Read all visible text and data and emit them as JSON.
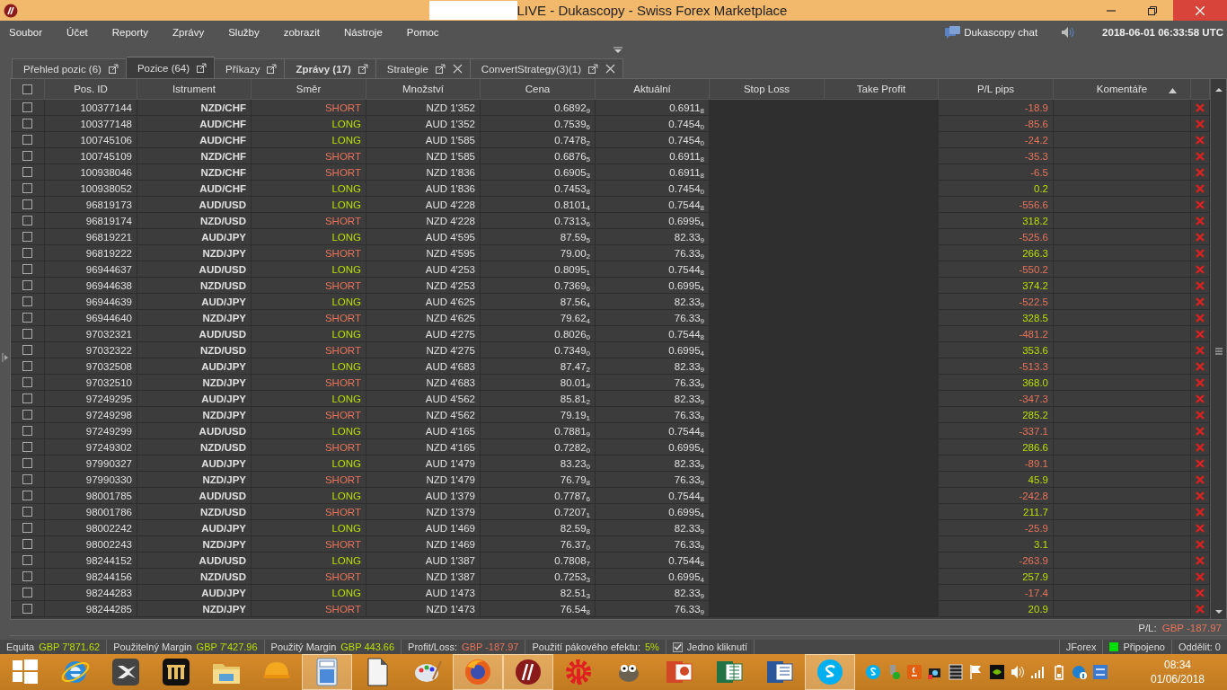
{
  "window": {
    "title": "LIVE - Dukascopy - Swiss Forex Marketplace"
  },
  "menu": [
    "Soubor",
    "Účet",
    "Reporty",
    "Zprávy",
    "Služby",
    "zobrazit",
    "Nástroje",
    "Pomoc"
  ],
  "chat_label": "Dukascopy chat",
  "server_time": "2018-06-01 06:33:58 UTC",
  "tabs": [
    {
      "label": "Přehled pozic (6)",
      "selected": false,
      "closable": false,
      "unread": false
    },
    {
      "label": "Pozice (64)",
      "selected": true,
      "closable": false,
      "unread": false
    },
    {
      "label": "Příkazy",
      "selected": false,
      "closable": false,
      "unread": false
    },
    {
      "label": "Zprávy (17)",
      "selected": false,
      "closable": false,
      "unread": true
    },
    {
      "label": "Strategie",
      "selected": false,
      "closable": true,
      "unread": false
    },
    {
      "label": "ConvertStrategy(3)(1)",
      "selected": false,
      "closable": true,
      "unread": false
    }
  ],
  "table": {
    "select_all_checked": false,
    "columns": [
      {
        "label": "Pos. ID",
        "sorted": false
      },
      {
        "label": "Istrument",
        "sorted": false
      },
      {
        "label": "Směr",
        "sorted": false
      },
      {
        "label": "Množství",
        "sorted": false
      },
      {
        "label": "Cena",
        "sorted": false
      },
      {
        "label": "Aktuální",
        "sorted": false
      },
      {
        "label": "Stop Loss",
        "sorted": false
      },
      {
        "label": "Take Profit",
        "sorted": false
      },
      {
        "label": "P/L pips",
        "sorted": false
      },
      {
        "label": "Komentáře",
        "sorted": true
      }
    ],
    "rows": [
      {
        "checked": false,
        "id": "100377144",
        "instrument": "NZD/CHF",
        "side": "SHORT",
        "long": false,
        "amount": "NZD 1'352",
        "price": "0.6892$_{9}$",
        "current": "0.6911$_{8}$",
        "pl": "-18.9",
        "gain": false
      },
      {
        "checked": false,
        "id": "100377148",
        "instrument": "AUD/CHF",
        "side": "LONG",
        "long": true,
        "amount": "AUD 1'352",
        "price": "0.7539$_{6}$",
        "current": "0.7454$_{0}$",
        "pl": "-85.6",
        "gain": false
      },
      {
        "checked": false,
        "id": "100745106",
        "instrument": "AUD/CHF",
        "side": "LONG",
        "long": true,
        "amount": "AUD 1'585",
        "price": "0.7478$_{2}$",
        "current": "0.7454$_{0}$",
        "pl": "-24.2",
        "gain": false
      },
      {
        "checked": false,
        "id": "100745109",
        "instrument": "NZD/CHF",
        "side": "SHORT",
        "long": false,
        "amount": "NZD 1'585",
        "price": "0.6876$_{5}$",
        "current": "0.6911$_{8}$",
        "pl": "-35.3",
        "gain": false
      },
      {
        "checked": false,
        "id": "100938046",
        "instrument": "NZD/CHF",
        "side": "SHORT",
        "long": false,
        "amount": "NZD 1'836",
        "price": "0.6905$_{3}$",
        "current": "0.6911$_{8}$",
        "pl": "-6.5",
        "gain": false
      },
      {
        "checked": false,
        "id": "100938052",
        "instrument": "AUD/CHF",
        "side": "LONG",
        "long": true,
        "amount": "AUD 1'836",
        "price": "0.7453$_{8}$",
        "current": "0.7454$_{0}$",
        "pl": "0.2",
        "gain": true
      },
      {
        "checked": false,
        "id": "96819173",
        "instrument": "AUD/USD",
        "side": "LONG",
        "long": true,
        "amount": "AUD 4'228",
        "price": "0.8101$_{4}$",
        "current": "0.7544$_{8}$",
        "pl": "-556.6",
        "gain": false
      },
      {
        "checked": false,
        "id": "96819174",
        "instrument": "NZD/USD",
        "side": "SHORT",
        "long": false,
        "amount": "NZD 4'228",
        "price": "0.7313$_{6}$",
        "current": "0.6995$_{4}$",
        "pl": "318.2",
        "gain": true
      },
      {
        "checked": false,
        "id": "96819221",
        "instrument": "AUD/JPY",
        "side": "LONG",
        "long": true,
        "amount": "AUD 4'595",
        "price": "87.59$_{5}$",
        "current": "82.33$_{9}$",
        "pl": "-525.6",
        "gain": false
      },
      {
        "checked": false,
        "id": "96819222",
        "instrument": "NZD/JPY",
        "side": "SHORT",
        "long": false,
        "amount": "NZD 4'595",
        "price": "79.00$_{2}$",
        "current": "76.33$_{9}$",
        "pl": "266.3",
        "gain": true
      },
      {
        "checked": false,
        "id": "96944637",
        "instrument": "AUD/USD",
        "side": "LONG",
        "long": true,
        "amount": "AUD 4'253",
        "price": "0.8095$_{1}$",
        "current": "0.7544$_{8}$",
        "pl": "-550.2",
        "gain": false
      },
      {
        "checked": false,
        "id": "96944638",
        "instrument": "NZD/USD",
        "side": "SHORT",
        "long": false,
        "amount": "NZD 4'253",
        "price": "0.7369$_{6}$",
        "current": "0.6995$_{4}$",
        "pl": "374.2",
        "gain": true
      },
      {
        "checked": false,
        "id": "96944639",
        "instrument": "AUD/JPY",
        "side": "LONG",
        "long": true,
        "amount": "AUD 4'625",
        "price": "87.56$_{4}$",
        "current": "82.33$_{9}$",
        "pl": "-522.5",
        "gain": false
      },
      {
        "checked": false,
        "id": "96944640",
        "instrument": "NZD/JPY",
        "side": "SHORT",
        "long": false,
        "amount": "NZD 4'625",
        "price": "79.62$_{4}$",
        "current": "76.33$_{9}$",
        "pl": "328.5",
        "gain": true
      },
      {
        "checked": false,
        "id": "97032321",
        "instrument": "AUD/USD",
        "side": "LONG",
        "long": true,
        "amount": "AUD 4'275",
        "price": "0.8026$_{0}$",
        "current": "0.7544$_{8}$",
        "pl": "-481.2",
        "gain": false
      },
      {
        "checked": false,
        "id": "97032322",
        "instrument": "NZD/USD",
        "side": "SHORT",
        "long": false,
        "amount": "NZD 4'275",
        "price": "0.7349$_{0}$",
        "current": "0.6995$_{4}$",
        "pl": "353.6",
        "gain": true
      },
      {
        "checked": false,
        "id": "97032508",
        "instrument": "AUD/JPY",
        "side": "LONG",
        "long": true,
        "amount": "AUD 4'683",
        "price": "87.47$_{2}$",
        "current": "82.33$_{9}$",
        "pl": "-513.3",
        "gain": false
      },
      {
        "checked": false,
        "id": "97032510",
        "instrument": "NZD/JPY",
        "side": "SHORT",
        "long": false,
        "amount": "NZD 4'683",
        "price": "80.01$_{9}$",
        "current": "76.33$_{9}$",
        "pl": "368.0",
        "gain": true
      },
      {
        "checked": false,
        "id": "97249295",
        "instrument": "AUD/JPY",
        "side": "LONG",
        "long": true,
        "amount": "AUD 4'562",
        "price": "85.81$_{2}$",
        "current": "82.33$_{9}$",
        "pl": "-347.3",
        "gain": false
      },
      {
        "checked": false,
        "id": "97249298",
        "instrument": "NZD/JPY",
        "side": "SHORT",
        "long": false,
        "amount": "NZD 4'562",
        "price": "79.19$_{1}$",
        "current": "76.33$_{9}$",
        "pl": "285.2",
        "gain": true
      },
      {
        "checked": false,
        "id": "97249299",
        "instrument": "AUD/USD",
        "side": "LONG",
        "long": true,
        "amount": "AUD 4'165",
        "price": "0.7881$_{9}$",
        "current": "0.7544$_{8}$",
        "pl": "-337.1",
        "gain": false
      },
      {
        "checked": false,
        "id": "97249302",
        "instrument": "NZD/USD",
        "side": "SHORT",
        "long": false,
        "amount": "NZD 4'165",
        "price": "0.7282$_{0}$",
        "current": "0.6995$_{4}$",
        "pl": "286.6",
        "gain": true
      },
      {
        "checked": false,
        "id": "97990327",
        "instrument": "AUD/JPY",
        "side": "LONG",
        "long": true,
        "amount": "AUD 1'479",
        "price": "83.23$_{0}$",
        "current": "82.33$_{9}$",
        "pl": "-89.1",
        "gain": false
      },
      {
        "checked": false,
        "id": "97990330",
        "instrument": "NZD/JPY",
        "side": "SHORT",
        "long": false,
        "amount": "NZD 1'479",
        "price": "76.79$_{8}$",
        "current": "76.33$_{9}$",
        "pl": "45.9",
        "gain": true
      },
      {
        "checked": false,
        "id": "98001785",
        "instrument": "AUD/USD",
        "side": "LONG",
        "long": true,
        "amount": "AUD 1'379",
        "price": "0.7787$_{6}$",
        "current": "0.7544$_{8}$",
        "pl": "-242.8",
        "gain": false
      },
      {
        "checked": false,
        "id": "98001786",
        "instrument": "NZD/USD",
        "side": "SHORT",
        "long": false,
        "amount": "NZD 1'379",
        "price": "0.7207$_{1}$",
        "current": "0.6995$_{4}$",
        "pl": "211.7",
        "gain": true
      },
      {
        "checked": false,
        "id": "98002242",
        "instrument": "AUD/JPY",
        "side": "LONG",
        "long": true,
        "amount": "AUD 1'469",
        "price": "82.59$_{8}$",
        "current": "82.33$_{9}$",
        "pl": "-25.9",
        "gain": false
      },
      {
        "checked": false,
        "id": "98002243",
        "instrument": "NZD/JPY",
        "side": "SHORT",
        "long": false,
        "amount": "NZD 1'469",
        "price": "76.37$_{0}$",
        "current": "76.33$_{9}$",
        "pl": "3.1",
        "gain": true
      },
      {
        "checked": false,
        "id": "98244152",
        "instrument": "AUD/USD",
        "side": "LONG",
        "long": true,
        "amount": "AUD 1'387",
        "price": "0.7808$_{7}$",
        "current": "0.7544$_{8}$",
        "pl": "-263.9",
        "gain": false
      },
      {
        "checked": false,
        "id": "98244156",
        "instrument": "NZD/USD",
        "side": "SHORT",
        "long": false,
        "amount": "NZD 1'387",
        "price": "0.7253$_{3}$",
        "current": "0.6995$_{4}$",
        "pl": "257.9",
        "gain": true
      },
      {
        "checked": false,
        "id": "98244283",
        "instrument": "AUD/JPY",
        "side": "LONG",
        "long": true,
        "amount": "AUD 1'473",
        "price": "82.51$_{3}$",
        "current": "82.33$_{9}$",
        "pl": "-17.4",
        "gain": false
      },
      {
        "checked": false,
        "id": "98244285",
        "instrument": "NZD/JPY",
        "side": "SHORT",
        "long": false,
        "amount": "NZD 1'473",
        "price": "76.54$_{8}$",
        "current": "76.33$_{9}$",
        "pl": "20.9",
        "gain": true
      }
    ],
    "total": {
      "label": "P/L:",
      "value": "GBP -187.97"
    }
  },
  "status_bar": {
    "items": [
      {
        "label": "Equita",
        "value": "GBP 7'871.62",
        "kind": "gain"
      },
      {
        "label": "Použitelný Margin",
        "value": "GBP 7'427.96",
        "kind": "gain"
      },
      {
        "label": "Použitý Margin",
        "value": "GBP 443.66",
        "kind": "gain"
      },
      {
        "label": "Profit/Loss:",
        "value": "GBP -187.97",
        "kind": "loss"
      },
      {
        "label": "Použití pákového efektu:",
        "value": "5%",
        "kind": "gain"
      }
    ],
    "one_click": {
      "label": "Jedno kliknutí",
      "checked": true
    },
    "platform": "JForex",
    "connection": {
      "label": "Připojeno",
      "connected": true
    },
    "detach": "Oddělit: 0"
  },
  "taskbar": {
    "apps": [
      {
        "kind": "start",
        "active": false
      },
      {
        "kind": "ie",
        "active": false
      },
      {
        "kind": "x",
        "active": false
      },
      {
        "kind": "bars",
        "active": false
      },
      {
        "kind": "folder",
        "active": false
      },
      {
        "kind": "helmet",
        "active": false
      },
      {
        "kind": "calculator",
        "active": true
      },
      {
        "kind": "document",
        "active": false
      },
      {
        "kind": "palette",
        "active": false
      },
      {
        "kind": "firefox",
        "active": true
      },
      {
        "kind": "jforex",
        "active": true
      },
      {
        "kind": "gear",
        "active": false
      },
      {
        "kind": "gimp",
        "active": false
      },
      {
        "kind": "powerpoint",
        "active": false
      },
      {
        "kind": "excel",
        "active": false
      },
      {
        "kind": "word",
        "active": false
      },
      {
        "kind": "skype",
        "active": true
      }
    ],
    "tray": [
      {
        "kind": "skype"
      },
      {
        "kind": "usb"
      },
      {
        "kind": "java"
      },
      {
        "kind": "camera"
      },
      {
        "kind": "grid"
      },
      {
        "kind": "flag"
      },
      {
        "kind": "nvidia"
      },
      {
        "kind": "speaker"
      },
      {
        "kind": "signal"
      },
      {
        "kind": "battery"
      },
      {
        "kind": "info"
      },
      {
        "kind": "exchange"
      }
    ],
    "time": "08:34",
    "date": "01/06/2018"
  }
}
